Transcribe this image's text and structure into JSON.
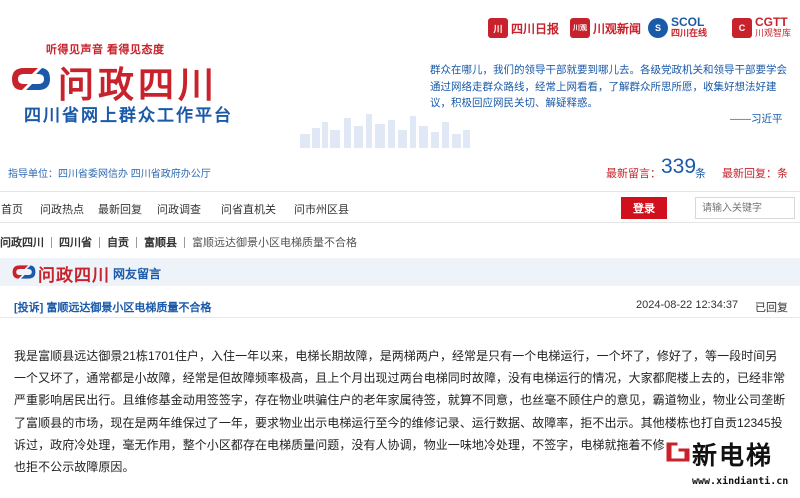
{
  "header": {
    "slogan": "听得见声音  看得见态度",
    "site_name": "问政四川",
    "site_subtitle": "四川省网上群众工作平台",
    "partners": [
      {
        "label": "四川日报",
        "icon": "sichuan-daily-icon",
        "icon_text": "川"
      },
      {
        "label": "川观新闻",
        "icon": "chuanguan-icon",
        "icon_text": "川观"
      },
      {
        "label": "SCOL",
        "label2": "四川在线",
        "icon": "scol-icon",
        "icon_text": "S"
      },
      {
        "label": "CGTT",
        "label2": "川观智库",
        "icon": "cgtt-icon",
        "icon_text": "C"
      }
    ],
    "quote": "群众在哪儿，我们的领导干部就要到哪儿去。各级党政机关和领导干部要学会通过网络走群众路线，经常上网看看，了解群众所思所愿，收集好想法好建议，积极回应网民关切、解疑释惑。",
    "quote_author": "——习近平"
  },
  "info": {
    "guide": "指导单位：四川省委网信办  四川省政府办公厅",
    "latest_label": "最新留言：",
    "latest_count": "339",
    "latest_unit": "条",
    "reply_label": "最新回复：条"
  },
  "nav": {
    "items": [
      "首页",
      "问政热点",
      "最新回复",
      "问政调查",
      "问省直机关",
      "问市州区县"
    ],
    "login": "登录",
    "search_placeholder": "请输入关键字"
  },
  "breadcrumb": [
    "问政四川",
    "四川省",
    "自贡",
    "富顺县",
    "富顺远达御景小区电梯质量不合格"
  ],
  "board": {
    "name": "问政四川",
    "tag": "网友留言"
  },
  "post": {
    "title": "[投诉] 富顺远达御景小区电梯质量不合格",
    "time": "2024-08-22 12:34:37",
    "status": "已回复",
    "lines": [
      "我是富顺县远达御景21栋1701住户，入住一年以来，电梯长期故障，是两梯两户，经常是只有一个电梯运行，一个坏了，修好了，等一段时间另",
      "一个又坏了，通常都是小故障，经常是但故障频率极高，且上个月出现过两台电梯同时故障，没有电梯运行的情况，大家都爬楼上去的，已经非常",
      "严重影响居民出行。且维修基金动用签签字，存在物业哄骗住户的老年家属待签，就算不同意，也丝毫不顾住户的意见，霸道物业，物业公司垄断",
      "了富顺县的市场，现在是两年维保过了一年，要求物业出示电梯运行至今的维修记录、运行数据、故障率，拒不出示。其他楼栋也打自贡12345投",
      "诉过，政府冷处理，毫无作用，整个小区都存在电梯质量问题，没有人协调，物业一味地冷处理，不签字，电梯就拖着不修，",
      "也拒不公示故障原因。"
    ]
  },
  "watermark": {
    "title": "新电梯",
    "url": "www.xindianti.cn"
  },
  "colors": {
    "brand_red": "#c8232c",
    "brand_blue": "#1a5aa8",
    "login_red": "#d0111b"
  }
}
